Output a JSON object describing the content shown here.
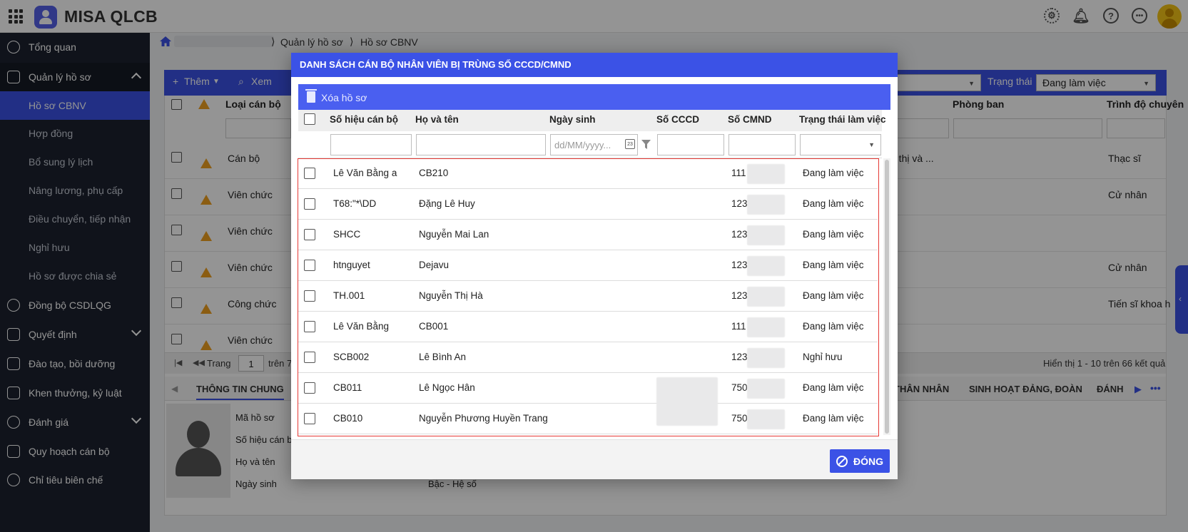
{
  "app": {
    "title": "MISA QLCB"
  },
  "breadcrumb": {
    "items": [
      "Quản lý hồ sơ",
      "Hồ sơ CBNV"
    ]
  },
  "sidebar": {
    "items": [
      {
        "label": "Tổng quan",
        "type": "main",
        "icon": "pie-chart-icon"
      },
      {
        "label": "Quản lý hồ sơ",
        "type": "section",
        "icon": "profile-card-icon",
        "expanded": true
      },
      {
        "label": "Hồ sơ CBNV",
        "type": "sub",
        "active": true
      },
      {
        "label": "Hợp đồng",
        "type": "sub"
      },
      {
        "label": "Bổ sung lý lịch",
        "type": "sub"
      },
      {
        "label": "Nâng lương, phụ cấp",
        "type": "sub"
      },
      {
        "label": "Điều chuyển, tiếp nhận",
        "type": "sub"
      },
      {
        "label": "Nghỉ hưu",
        "type": "sub"
      },
      {
        "label": "Hồ sơ được chia sẻ",
        "type": "sub"
      },
      {
        "label": "Đồng bộ CSDLQG",
        "type": "main",
        "icon": "sync-icon"
      },
      {
        "label": "Quyết định",
        "type": "main",
        "icon": "document-icon",
        "expandable": true
      },
      {
        "label": "Đào tạo, bồi dưỡng",
        "type": "main",
        "icon": "training-icon"
      },
      {
        "label": "Khen thưởng, kỷ luật",
        "type": "main",
        "icon": "trophy-icon"
      },
      {
        "label": "Đánh giá",
        "type": "main",
        "icon": "award-icon",
        "expandable": true
      },
      {
        "label": "Quy hoạch cán bộ",
        "type": "main",
        "icon": "users-icon"
      },
      {
        "label": "Chỉ tiêu biên chế",
        "type": "main",
        "icon": "target-icon"
      }
    ]
  },
  "background": {
    "toolbar": {
      "add": "Thêm",
      "view": "Xem",
      "status_label": "Trạng thái",
      "status_value": "Đang làm việc"
    },
    "columns": [
      "Loại cán bộ",
      "Phòng ban",
      "Trình độ chuyên"
    ],
    "rows": [
      {
        "type": "Cán bộ",
        "dept": "ô thị và ...",
        "level": "Thạc sĩ"
      },
      {
        "type": "Viên chức",
        "dept": "",
        "level": "Cử nhân"
      },
      {
        "type": "Viên chức",
        "dept": "",
        "level": ""
      },
      {
        "type": "Viên chức",
        "dept": "",
        "level": "Cử nhân"
      },
      {
        "type": "Công chức",
        "dept": "",
        "level": "Tiến sĩ khoa h"
      },
      {
        "type": "Viên chức",
        "dept": "",
        "level": ""
      }
    ],
    "pager": {
      "page_label": "Trang",
      "page": "1",
      "of_label": "trên 7",
      "summary": "Hiển thị 1 - 10 trên 66 kết quả"
    },
    "tabs": [
      "THÔNG TIN CHUNG",
      "THÂN NHÂN",
      "SINH HOẠT ĐẢNG, ĐOÀN",
      "ĐÁNH"
    ],
    "info_labels": [
      "Mã hồ sơ",
      "Số hiệu cán b",
      "Họ và tên",
      "Ngày sinh"
    ],
    "info_extra": "Bậc - Hệ số"
  },
  "dialog": {
    "title": "DANH SÁCH CÁN BỘ NHÂN VIÊN BỊ TRÙNG SỐ CCCD/CMND",
    "delete_label": "Xóa hồ sơ",
    "columns": {
      "code": "Số hiệu cán bộ",
      "name": "Họ và tên",
      "dob": "Ngày sinh",
      "cccd": "Số CCCD",
      "cmnd": "Số CMND",
      "status": "Trạng thái làm việc"
    },
    "date_placeholder": "dd/MM/yyyy...",
    "rows": [
      {
        "code": "Lê Văn Bằng a",
        "name": "CB210",
        "cmnd": "111",
        "status": "Đang làm việc"
      },
      {
        "code": "T68:\"*\\DD",
        "name": "Đặng Lê Huy",
        "cmnd": "123",
        "status": "Đang làm việc"
      },
      {
        "code": "SHCC",
        "name": "Nguyễn Mai Lan",
        "cmnd": "123",
        "status": "Đang làm việc"
      },
      {
        "code": "htnguyet",
        "name": "Dejavu",
        "cmnd": "123",
        "status": "Đang làm việc"
      },
      {
        "code": "TH.001",
        "name": "Nguyễn Thị Hà",
        "cmnd": "123",
        "status": "Đang làm việc"
      },
      {
        "code": "Lê Văn Bằng",
        "name": "CB001",
        "cmnd": "111",
        "status": "Đang làm việc"
      },
      {
        "code": "SCB002",
        "name": "Lê Bình An",
        "cmnd": "123",
        "status": "Nghỉ hưu"
      },
      {
        "code": "CB011",
        "name": "Lê Ngọc Hân",
        "cmnd": "750",
        "status": "Đang làm việc"
      },
      {
        "code": "CB010",
        "name": "Nguyễn Phương Huyền Trang",
        "cmnd": "750",
        "status": "Đang làm việc"
      }
    ],
    "close_label": "ĐÓNG"
  },
  "colors": {
    "primary": "#3b52e6",
    "sidebar": "#1c2230",
    "highlight_border": "#e53935",
    "warning": "#f0a020"
  }
}
